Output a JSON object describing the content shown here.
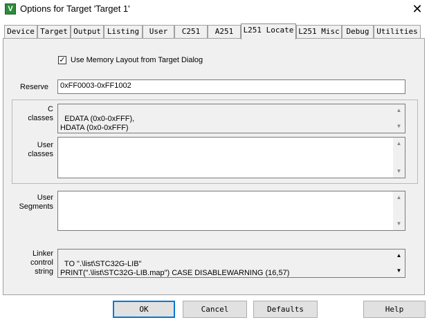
{
  "window": {
    "title": "Options for Target 'Target 1'",
    "icon": "uvision-logo",
    "icon_glyph": "V",
    "close_glyph": "✕"
  },
  "tabs": [
    {
      "label": "Device",
      "active": false
    },
    {
      "label": "Target",
      "active": false
    },
    {
      "label": "Output",
      "active": false
    },
    {
      "label": "Listing",
      "active": false
    },
    {
      "label": "User",
      "active": false
    },
    {
      "label": "C251",
      "active": false
    },
    {
      "label": "A251",
      "active": false
    },
    {
      "label": "L251 Locate",
      "active": true
    },
    {
      "label": "L251 Misc",
      "active": false
    },
    {
      "label": "Debug",
      "active": false
    },
    {
      "label": "Utilities",
      "active": false
    }
  ],
  "options": {
    "use_memory_layout": {
      "label": "Use Memory Layout from Target Dialog",
      "checked": true,
      "glyph": "✓"
    }
  },
  "reserve": {
    "label": "Reserve",
    "value": "0xFF0003-0xFF1002"
  },
  "c_classes": {
    "label_line1": "C",
    "label_line2": "classes",
    "value": "EDATA (0x0-0xFFF),\nHDATA (0x0-0xFFF)"
  },
  "user_classes": {
    "label_line1": "User",
    "label_line2": "classes",
    "value": ""
  },
  "user_segments": {
    "label_line1": "User",
    "label_line2": "Segments",
    "value": ""
  },
  "linker_control": {
    "label_line1": "Linker",
    "label_line2": "control",
    "label_line3": "string",
    "value": "TO \".\\list\\STC32G-LIB\"\nPRINT(\".\\list\\STC32G-LIB.map\") CASE DISABLEWARNING (16,57)"
  },
  "scroll": {
    "up_glyph": "▲",
    "down_glyph": "▼"
  },
  "buttons": {
    "ok": "OK",
    "cancel": "Cancel",
    "defaults": "Defaults",
    "help": "Help"
  },
  "colors": {
    "dialog_bg": "#f0f0f0",
    "focus_border": "#0078d7"
  }
}
